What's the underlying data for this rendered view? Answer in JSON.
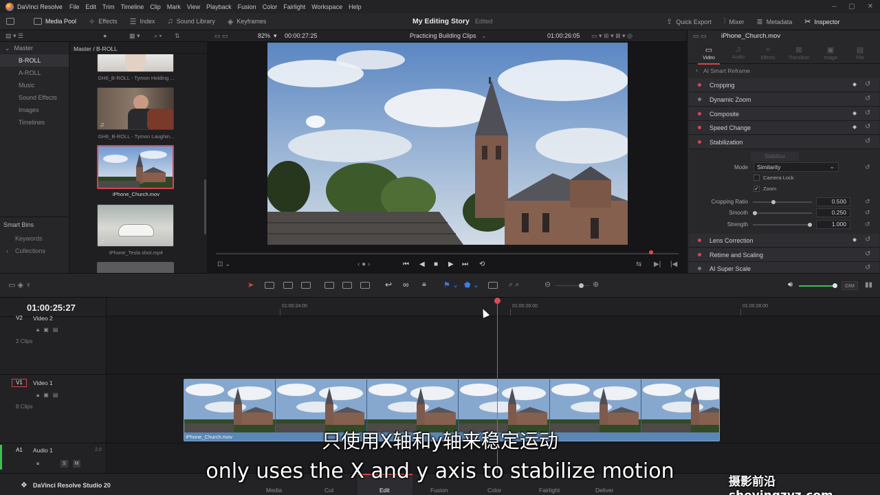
{
  "app": {
    "name": "DaVinci Resolve",
    "menu": [
      "File",
      "Edit",
      "Trim",
      "Timeline",
      "Clip",
      "Mark",
      "View",
      "Playback",
      "Fusion",
      "Color",
      "Fairlight",
      "Workspace",
      "Help"
    ]
  },
  "toolbar": {
    "left": [
      {
        "label": "Media Pool",
        "icon": "media-pool-icon"
      },
      {
        "label": "Effects",
        "icon": "effects-icon"
      },
      {
        "label": "Index",
        "icon": "index-icon"
      },
      {
        "label": "Sound Library",
        "icon": "sound-library-icon"
      },
      {
        "label": "Keyframes",
        "icon": "keyframes-icon"
      }
    ],
    "project_title": "My Editing Story",
    "project_status": "Edited",
    "right": [
      {
        "label": "Quick Export",
        "icon": "export-icon"
      },
      {
        "label": "Mixer",
        "icon": "mixer-icon"
      },
      {
        "label": "Metadata",
        "icon": "metadata-icon"
      },
      {
        "label": "Inspector",
        "icon": "inspector-icon"
      }
    ]
  },
  "viewer_bar": {
    "zoom": "82%",
    "source_timecode": "00:00:27:25",
    "timeline_name": "Practicing Building Clips",
    "record_timecode": "01:00:26:05"
  },
  "bins": {
    "master": "Master",
    "items": [
      "B-ROLL",
      "A-ROLL",
      "Music",
      "Sound Effects",
      "Images",
      "Timelines"
    ],
    "selected": "B-ROLL",
    "smart_bins_title": "Smart Bins",
    "smart_bins": [
      "Keywords",
      "Collections"
    ]
  },
  "media_pool": {
    "path": "Master / B-ROLL",
    "clips": [
      {
        "name": "GH6_B-ROLL - Tymon Holding ...",
        "audio": true
      },
      {
        "name": "GH6_B-ROLL - Tymon Laughin...",
        "audio": true
      },
      {
        "name": "iPhone_Church.mov",
        "audio": false,
        "selected": true
      },
      {
        "name": "iPhone_Tesla shot.mp4",
        "audio": true
      }
    ]
  },
  "inspector": {
    "clip_name": "iPhone_Church.mov",
    "tabs": [
      "Video",
      "Audio",
      "Effects",
      "Transition",
      "Image",
      "File"
    ],
    "active_tab": "Video",
    "first_row": "AI Smart Reframe",
    "sections": [
      {
        "label": "Cropping",
        "enabled": true,
        "keyframe": true
      },
      {
        "label": "Dynamic Zoom",
        "enabled": false,
        "keyframe": false
      },
      {
        "label": "Composite",
        "enabled": true,
        "keyframe": true
      },
      {
        "label": "Speed Change",
        "enabled": true,
        "keyframe": true
      },
      {
        "label": "Stabilization",
        "enabled": true,
        "keyframe": false
      }
    ],
    "stabilize_button": "Stabilize",
    "mode_label": "Mode",
    "mode_value": "Similarity",
    "camera_lock_label": "Camera Lock",
    "camera_lock": false,
    "zoom_label": "Zoom",
    "zoom": true,
    "params": [
      {
        "label": "Cropping Ratio",
        "value": "0.500",
        "fraction": 0.34
      },
      {
        "label": "Smooth",
        "value": "0.250",
        "fraction": 0.0
      },
      {
        "label": "Strength",
        "value": "1.000",
        "fraction": 1.0
      }
    ],
    "sections_after": [
      {
        "label": "Lens Correction",
        "enabled": true,
        "keyframe": true
      },
      {
        "label": "Retime and Scaling",
        "enabled": true,
        "keyframe": false
      },
      {
        "label": "AI Super Scale",
        "enabled": false,
        "keyframe": false
      }
    ]
  },
  "timeline": {
    "timecode": "01:00:25:27",
    "ruler": [
      "01:00:24:00",
      "01:00:26:00",
      "01:00:28:00"
    ],
    "tracks": [
      {
        "id": "V2",
        "name": "Video 2",
        "clips": "2 Clips"
      },
      {
        "id": "V1",
        "name": "Video 1",
        "clips": "8 Clips"
      },
      {
        "id": "A1",
        "name": "Audio 1",
        "level": "2.0",
        "solo": "S",
        "mute": "M"
      }
    ],
    "clip_name": "iPhone_Church.mov",
    "dim_label": "DIM",
    "volume_level": 0.95
  },
  "pages": {
    "studio": "DaVinci Resolve Studio 20",
    "tabs": [
      "Media",
      "Cut",
      "Edit",
      "Fusion",
      "Color",
      "Fairlight",
      "Deliver"
    ],
    "active": "Edit"
  },
  "subtitles": {
    "chinese": "只使用X轴和y轴来稳定运动",
    "english": "only uses the X and y axis to stabilize motion"
  },
  "watermark": "摄影前沿 sheyingzyz.com",
  "colors": {
    "accent": "#d8454f",
    "clip_blue": "#5b87b6",
    "volume_green": "#3fbf4f"
  }
}
